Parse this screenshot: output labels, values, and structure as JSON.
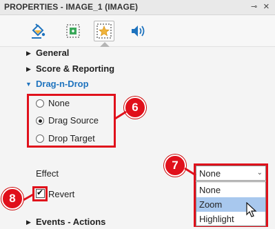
{
  "panel": {
    "title": "PROPERTIES - IMAGE_1 (IMAGE)",
    "pin_glyph": "⊸",
    "close_glyph": "×"
  },
  "tabs": [
    {
      "icon": "paint-bucket-icon"
    },
    {
      "icon": "size-position-icon"
    },
    {
      "icon": "star-interaction-icon",
      "active": true
    },
    {
      "icon": "speaker-audio-icon"
    }
  ],
  "sections": {
    "general": "General",
    "score": "Score & Reporting",
    "dragdrop": "Drag-n-Drop",
    "events": "Events - Actions"
  },
  "dragdrop": {
    "options": [
      "None",
      "Drag Source",
      "Drop Target"
    ],
    "selected": "Drag Source"
  },
  "effect": {
    "label": "Effect",
    "value": "None",
    "options": [
      "None",
      "Zoom",
      "Highlight"
    ],
    "hovered": "Zoom"
  },
  "revert": {
    "label": "Revert",
    "checked": true
  },
  "callouts": {
    "radio_group": "6",
    "effect_dropdown": "7",
    "revert_checkbox": "8"
  },
  "colors": {
    "accent": "#1e73be",
    "callout": "#e0101b",
    "highlight": "#a8c8ee"
  }
}
